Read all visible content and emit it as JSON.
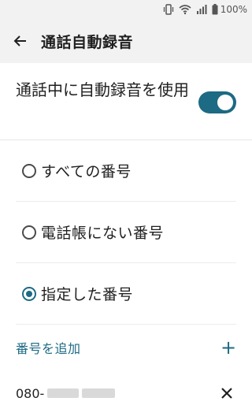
{
  "status_bar": {
    "battery_text": "100%",
    "icons": [
      "vibrate-icon",
      "wifi-icon",
      "signal-icon",
      "battery-icon"
    ]
  },
  "app_bar": {
    "back_icon": "back-arrow-icon",
    "title": "通話自動録音"
  },
  "main_toggle": {
    "label": "通話中に自動録音を使用",
    "enabled": true
  },
  "options": [
    {
      "label": "すべての番号",
      "selected": false
    },
    {
      "label": "電話帳にない番号",
      "selected": false
    },
    {
      "label": "指定した番号",
      "selected": true
    }
  ],
  "add_number": {
    "label": "番号を追加",
    "icon": "plus-icon"
  },
  "numbers": [
    {
      "visible_prefix": "080-",
      "remove_icon": "close-icon"
    }
  ],
  "colors": {
    "accent": "#1d6a84",
    "app_bar_bg": "#f2f2f2",
    "text": "#1f1f1f"
  }
}
